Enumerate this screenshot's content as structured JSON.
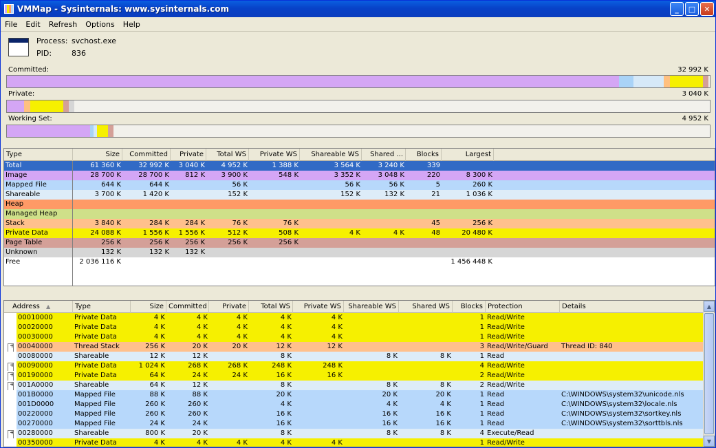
{
  "window": {
    "title": "VMMap - Sysinternals: www.sysinternals.com",
    "buttons": {
      "minimize": "_",
      "maximize": "□",
      "close": "✕"
    }
  },
  "menu": [
    "File",
    "Edit",
    "Refresh",
    "Options",
    "Help"
  ],
  "process": {
    "process_label": "Process:",
    "process_value": "svchost.exe",
    "pid_label": "PID:",
    "pid_value": "836"
  },
  "meters": [
    {
      "label": "Committed:",
      "value": "32 992 K",
      "segments": [
        {
          "color": "#d4a6f5",
          "pct": 87.1
        },
        {
          "color": "#a9d3f7",
          "pct": 2
        },
        {
          "color": "#d6e9f8",
          "pct": 4.3
        },
        {
          "color": "#ffc080",
          "pct": 0.9
        },
        {
          "color": "#f6f000",
          "pct": 4.7
        },
        {
          "color": "#d4a098",
          "pct": 0.8
        }
      ]
    },
    {
      "label": "Private:",
      "value": "3 040 K",
      "segments": [
        {
          "color": "#d4a6f5",
          "pct": 2.4
        },
        {
          "color": "#ffc080",
          "pct": 0.9
        },
        {
          "color": "#f6f000",
          "pct": 4.7
        },
        {
          "color": "#d4a098",
          "pct": 0.8
        },
        {
          "color": "#d6d6d6",
          "pct": 0.8
        }
      ]
    },
    {
      "label": "Working Set:",
      "value": "4 952 K",
      "segments": [
        {
          "color": "#d4a6f5",
          "pct": 11.8
        },
        {
          "color": "#a9d3f7",
          "pct": 0.5
        },
        {
          "color": "#d6e9f8",
          "pct": 0.5
        },
        {
          "color": "#f6f000",
          "pct": 1.6
        },
        {
          "color": "#d4a098",
          "pct": 0.8
        }
      ]
    }
  ],
  "summary": {
    "columns": [
      "Type",
      "Size",
      "Committed",
      "Private",
      "Total WS",
      "Private WS",
      "Shareable WS",
      "Shared ...",
      "Blocks",
      "Largest"
    ],
    "rows": [
      {
        "type": "Total",
        "size": "61 360 K",
        "committed": "32 992 K",
        "private": "3 040 K",
        "total_ws": "4 952 K",
        "private_ws": "1 388 K",
        "shareable_ws": "3 564 K",
        "shared_ws": "3 240 K",
        "blocks": "339",
        "largest": "",
        "bg": "#316ac5"
      },
      {
        "type": "Image",
        "size": "28 700 K",
        "committed": "28 700 K",
        "private": "812 K",
        "total_ws": "3 900 K",
        "private_ws": "548 K",
        "shareable_ws": "3 352 K",
        "shared_ws": "3 048 K",
        "blocks": "220",
        "largest": "8 300 K",
        "bg": "#d4a6f5"
      },
      {
        "type": "Mapped File",
        "size": "644 K",
        "committed": "644 K",
        "private": "",
        "total_ws": "56 K",
        "private_ws": "",
        "shareable_ws": "56 K",
        "shared_ws": "56 K",
        "blocks": "5",
        "largest": "260 K",
        "bg": "#b7d8fb"
      },
      {
        "type": "Shareable",
        "size": "3 700 K",
        "committed": "1 420 K",
        "private": "",
        "total_ws": "152 K",
        "private_ws": "",
        "shareable_ws": "152 K",
        "shared_ws": "132 K",
        "blocks": "21",
        "largest": "1 036 K",
        "bg": "#ddecf8"
      },
      {
        "type": "Heap",
        "size": "",
        "committed": "",
        "private": "",
        "total_ws": "",
        "private_ws": "",
        "shareable_ws": "",
        "shared_ws": "",
        "blocks": "",
        "largest": "",
        "bg": "#ff9a66"
      },
      {
        "type": "Managed Heap",
        "size": "",
        "committed": "",
        "private": "",
        "total_ws": "",
        "private_ws": "",
        "shareable_ws": "",
        "shared_ws": "",
        "blocks": "",
        "largest": "",
        "bg": "#cfe089"
      },
      {
        "type": "Stack",
        "size": "3 840 K",
        "committed": "284 K",
        "private": "284 K",
        "total_ws": "76 K",
        "private_ws": "76 K",
        "shareable_ws": "",
        "shared_ws": "",
        "blocks": "45",
        "largest": "256 K",
        "bg": "#ffc08c"
      },
      {
        "type": "Private Data",
        "size": "24 088 K",
        "committed": "1 556 K",
        "private": "1 556 K",
        "total_ws": "512 K",
        "private_ws": "508 K",
        "shareable_ws": "4 K",
        "shared_ws": "4 K",
        "blocks": "48",
        "largest": "20 480 K",
        "bg": "#f6f000"
      },
      {
        "type": "Page Table",
        "size": "256 K",
        "committed": "256 K",
        "private": "256 K",
        "total_ws": "256 K",
        "private_ws": "256 K",
        "shareable_ws": "",
        "shared_ws": "",
        "blocks": "",
        "largest": "",
        "bg": "#d4a098"
      },
      {
        "type": "Unknown",
        "size": "132 K",
        "committed": "132 K",
        "private": "132 K",
        "total_ws": "",
        "private_ws": "",
        "shareable_ws": "",
        "shared_ws": "",
        "blocks": "",
        "largest": "",
        "bg": "#d6d6d6"
      },
      {
        "type": "Free",
        "size": "2 036 116 K",
        "committed": "",
        "private": "",
        "total_ws": "",
        "private_ws": "",
        "shareable_ws": "",
        "shared_ws": "",
        "blocks": "",
        "largest": "1 456 448 K",
        "bg": "#ffffff"
      }
    ]
  },
  "details": {
    "columns": [
      "Address",
      "Type",
      "Size",
      "Committed",
      "Private",
      "Total WS",
      "Private WS",
      "Shareable WS",
      "Shared WS",
      "Blocks",
      "Protection",
      "Details"
    ],
    "sort_glyph": "▲",
    "rows": [
      {
        "exp": "",
        "address": "00010000",
        "type": "Private Data",
        "size": "4 K",
        "committed": "4 K",
        "private": "4 K",
        "total_ws": "4 K",
        "private_ws": "4 K",
        "shareable_ws": "",
        "shared_ws": "",
        "blocks": "1",
        "protection": "Read/Write",
        "details": "",
        "bg": "#f6f000"
      },
      {
        "exp": "",
        "address": "00020000",
        "type": "Private Data",
        "size": "4 K",
        "committed": "4 K",
        "private": "4 K",
        "total_ws": "4 K",
        "private_ws": "4 K",
        "shareable_ws": "",
        "shared_ws": "",
        "blocks": "1",
        "protection": "Read/Write",
        "details": "",
        "bg": "#f6f000"
      },
      {
        "exp": "",
        "address": "00030000",
        "type": "Private Data",
        "size": "4 K",
        "committed": "4 K",
        "private": "4 K",
        "total_ws": "4 K",
        "private_ws": "4 K",
        "shareable_ws": "",
        "shared_ws": "",
        "blocks": "1",
        "protection": "Read/Write",
        "details": "",
        "bg": "#f6f000"
      },
      {
        "exp": "+",
        "address": "00040000",
        "type": "Thread Stack",
        "size": "256 K",
        "committed": "20 K",
        "private": "20 K",
        "total_ws": "12 K",
        "private_ws": "12 K",
        "shareable_ws": "",
        "shared_ws": "",
        "blocks": "3",
        "protection": "Read/Write/Guard",
        "details": "Thread ID: 840",
        "bg": "#ffc08c"
      },
      {
        "exp": "",
        "address": "00080000",
        "type": "Shareable",
        "size": "12 K",
        "committed": "12 K",
        "private": "",
        "total_ws": "8 K",
        "private_ws": "",
        "shareable_ws": "8 K",
        "shared_ws": "8 K",
        "blocks": "1",
        "protection": "Read",
        "details": "",
        "bg": "#ddecf8"
      },
      {
        "exp": "+",
        "address": "00090000",
        "type": "Private Data",
        "size": "1 024 K",
        "committed": "268 K",
        "private": "268 K",
        "total_ws": "248 K",
        "private_ws": "248 K",
        "shareable_ws": "",
        "shared_ws": "",
        "blocks": "4",
        "protection": "Read/Write",
        "details": "",
        "bg": "#f6f000"
      },
      {
        "exp": "+",
        "address": "00190000",
        "type": "Private Data",
        "size": "64 K",
        "committed": "24 K",
        "private": "24 K",
        "total_ws": "16 K",
        "private_ws": "16 K",
        "shareable_ws": "",
        "shared_ws": "",
        "blocks": "2",
        "protection": "Read/Write",
        "details": "",
        "bg": "#f6f000"
      },
      {
        "exp": "+",
        "address": "001A0000",
        "type": "Shareable",
        "size": "64 K",
        "committed": "12 K",
        "private": "",
        "total_ws": "8 K",
        "private_ws": "",
        "shareable_ws": "8 K",
        "shared_ws": "8 K",
        "blocks": "2",
        "protection": "Read/Write",
        "details": "",
        "bg": "#ddecf8"
      },
      {
        "exp": "",
        "address": "001B0000",
        "type": "Mapped File",
        "size": "88 K",
        "committed": "88 K",
        "private": "",
        "total_ws": "20 K",
        "private_ws": "",
        "shareable_ws": "20 K",
        "shared_ws": "20 K",
        "blocks": "1",
        "protection": "Read",
        "details": "C:\\WINDOWS\\system32\\unicode.nls",
        "bg": "#b7d8fb"
      },
      {
        "exp": "",
        "address": "001D0000",
        "type": "Mapped File",
        "size": "260 K",
        "committed": "260 K",
        "private": "",
        "total_ws": "4 K",
        "private_ws": "",
        "shareable_ws": "4 K",
        "shared_ws": "4 K",
        "blocks": "1",
        "protection": "Read",
        "details": "C:\\WINDOWS\\system32\\locale.nls",
        "bg": "#b7d8fb"
      },
      {
        "exp": "",
        "address": "00220000",
        "type": "Mapped File",
        "size": "260 K",
        "committed": "260 K",
        "private": "",
        "total_ws": "16 K",
        "private_ws": "",
        "shareable_ws": "16 K",
        "shared_ws": "16 K",
        "blocks": "1",
        "protection": "Read",
        "details": "C:\\WINDOWS\\system32\\sortkey.nls",
        "bg": "#b7d8fb"
      },
      {
        "exp": "",
        "address": "00270000",
        "type": "Mapped File",
        "size": "24 K",
        "committed": "24 K",
        "private": "",
        "total_ws": "16 K",
        "private_ws": "",
        "shareable_ws": "16 K",
        "shared_ws": "16 K",
        "blocks": "1",
        "protection": "Read",
        "details": "C:\\WINDOWS\\system32\\sorttbls.nls",
        "bg": "#b7d8fb"
      },
      {
        "exp": "+",
        "address": "00280000",
        "type": "Shareable",
        "size": "800 K",
        "committed": "20 K",
        "private": "",
        "total_ws": "8 K",
        "private_ws": "",
        "shareable_ws": "8 K",
        "shared_ws": "8 K",
        "blocks": "4",
        "protection": "Execute/Read",
        "details": "",
        "bg": "#ddecf8"
      },
      {
        "exp": "",
        "address": "00350000",
        "type": "Private Data",
        "size": "4 K",
        "committed": "4 K",
        "private": "4 K",
        "total_ws": "4 K",
        "private_ws": "4 K",
        "shareable_ws": "",
        "shared_ws": "",
        "blocks": "1",
        "protection": "Read/Write",
        "details": "",
        "bg": "#f6f000"
      }
    ]
  }
}
